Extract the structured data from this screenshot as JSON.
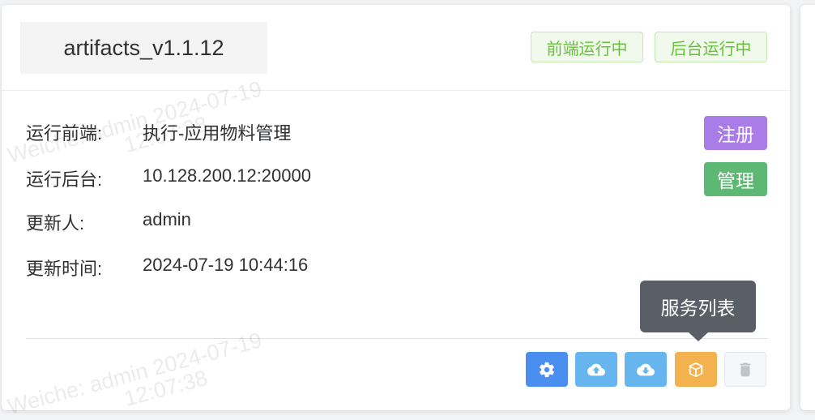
{
  "card": {
    "title": "artifacts_v1.1.12",
    "tags": [
      "前端运行中",
      "后台运行中"
    ],
    "fields": [
      {
        "label": "运行前端:",
        "value": "执行-应用物料管理"
      },
      {
        "label": "运行后台:",
        "value": "10.128.200.12:20000"
      },
      {
        "label": "更新人:",
        "value": "admin"
      },
      {
        "label": "更新时间:",
        "value": "2024-07-19 10:44:16"
      }
    ],
    "badges": {
      "register": "注册",
      "manage": "管理"
    },
    "tooltip": "服务列表",
    "buttons": [
      {
        "icon": "gear-icon",
        "color": "#4a8ef0"
      },
      {
        "icon": "cloud-upload-icon",
        "color": "#66b5ee"
      },
      {
        "icon": "cloud-download-icon",
        "color": "#66b5ee"
      },
      {
        "icon": "box-icon",
        "color": "#f3b24d"
      },
      {
        "icon": "trash-icon",
        "color": "#f5f7fa"
      }
    ]
  },
  "watermark": {
    "line1": "Weiche: admin 2024-07-19",
    "line2": "12:07:38",
    "line3": "Weiche: admin 2024-07-19",
    "line4": "12:07:38"
  }
}
